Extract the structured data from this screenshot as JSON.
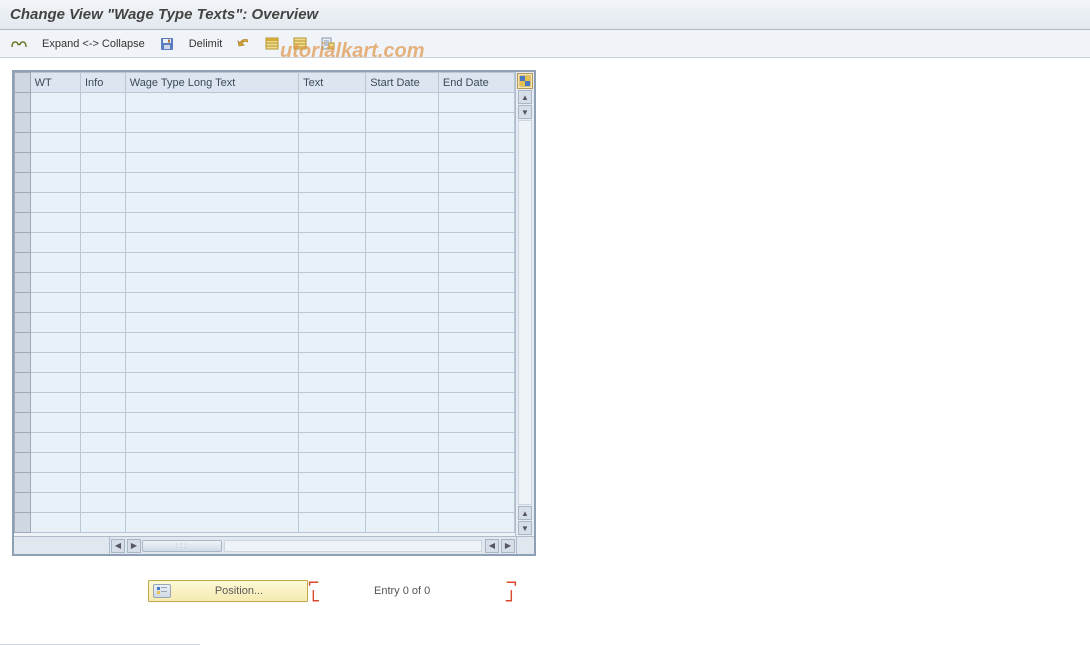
{
  "title": "Change View \"Wage Type Texts\": Overview",
  "toolbar": {
    "expand_collapse_label": "Expand <-> Collapse",
    "delimit_label": "Delimit"
  },
  "columns": {
    "wt": "WT",
    "info": "Info",
    "long": "Wage Type Long Text",
    "text": "Text",
    "start": "Start Date",
    "end": "End Date"
  },
  "row_count": 22,
  "position_button_label": "Position...",
  "entry_text": "Entry 0 of 0",
  "watermark": "utorialkart.com"
}
